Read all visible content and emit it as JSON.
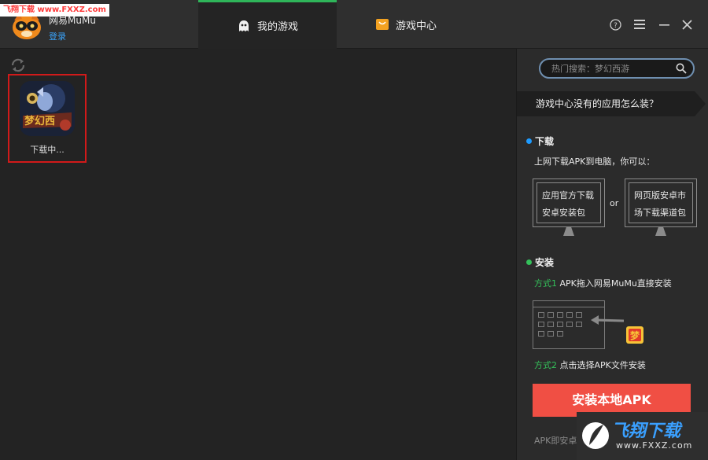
{
  "watermark": "飞翔下载 www.FXXZ.com",
  "header": {
    "app_name": "网易MuMu",
    "user_link": "登录",
    "tabs": [
      {
        "label": "我的游戏",
        "active": true,
        "icon": "ghost-icon"
      },
      {
        "label": "游戏中心",
        "active": false,
        "icon": "shopping-bag-icon"
      }
    ],
    "window_buttons": [
      "help-icon",
      "menu-icon",
      "minimize-icon",
      "close-icon"
    ]
  },
  "games": [
    {
      "label": "下载中...",
      "icon": "game-thumbnail",
      "selected": true
    }
  ],
  "sidebar": {
    "search": {
      "placeholder": "热门搜索：梦幻西游"
    },
    "question": "游戏中心没有的应用怎么装？",
    "download": {
      "title": "下载",
      "desc": "上网下载APK到电脑，你可以：",
      "option1": [
        "应用官方下载",
        "安卓安装包"
      ],
      "or": "or",
      "option2": [
        "网页版安卓市",
        "场下载渠道包"
      ]
    },
    "install": {
      "title": "安装",
      "method1_prefix": "方式1",
      "method1_text": " APK拖入网易MuMu直接安装",
      "method2_prefix": "方式2",
      "method2_text": " 点击选择APK文件安装"
    },
    "install_button": "安装本地APK",
    "footer_note": "APK即安卓"
  },
  "logo_watermark": {
    "title": "飞翔下载",
    "url": "www.FXXZ.com"
  },
  "colors": {
    "accent_green": "#2fb55a",
    "download_dot": "#1e9bff",
    "install_dot": "#34c15a",
    "install_button": "#f04f44",
    "selection_border": "#d11a1a"
  }
}
